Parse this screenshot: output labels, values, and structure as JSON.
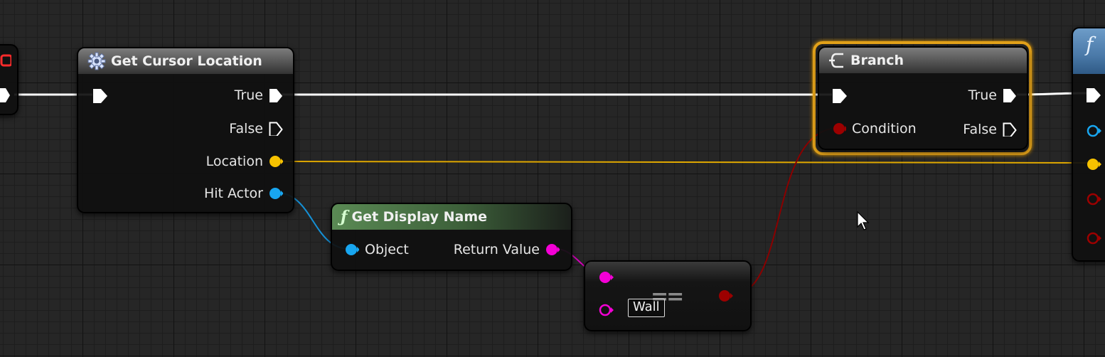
{
  "colors": {
    "exec": "#ffffff",
    "vector_pin": "#f7c200",
    "object_pin": "#18a6f0",
    "string_pin": "#f400d6",
    "bool_pin": "#9c0000",
    "selection": "#e3a21a",
    "grid_bg": "#262626"
  },
  "nodes": {
    "get_cursor": {
      "title": "Get Cursor Location",
      "icon": "gear-icon",
      "outputs": [
        "True",
        "False",
        "Location",
        "Hit Actor"
      ]
    },
    "get_display_name": {
      "title": "Get Display Name",
      "icon": "function-icon",
      "input": "Object",
      "output": "Return Value"
    },
    "equal": {
      "operator": "==",
      "literal": "Wall"
    },
    "branch": {
      "title": "Branch",
      "icon": "branch-icon",
      "input": "Condition",
      "outputs": [
        "True",
        "False"
      ]
    },
    "right_node": {
      "icon": "function-icon",
      "glyph": "f"
    }
  }
}
